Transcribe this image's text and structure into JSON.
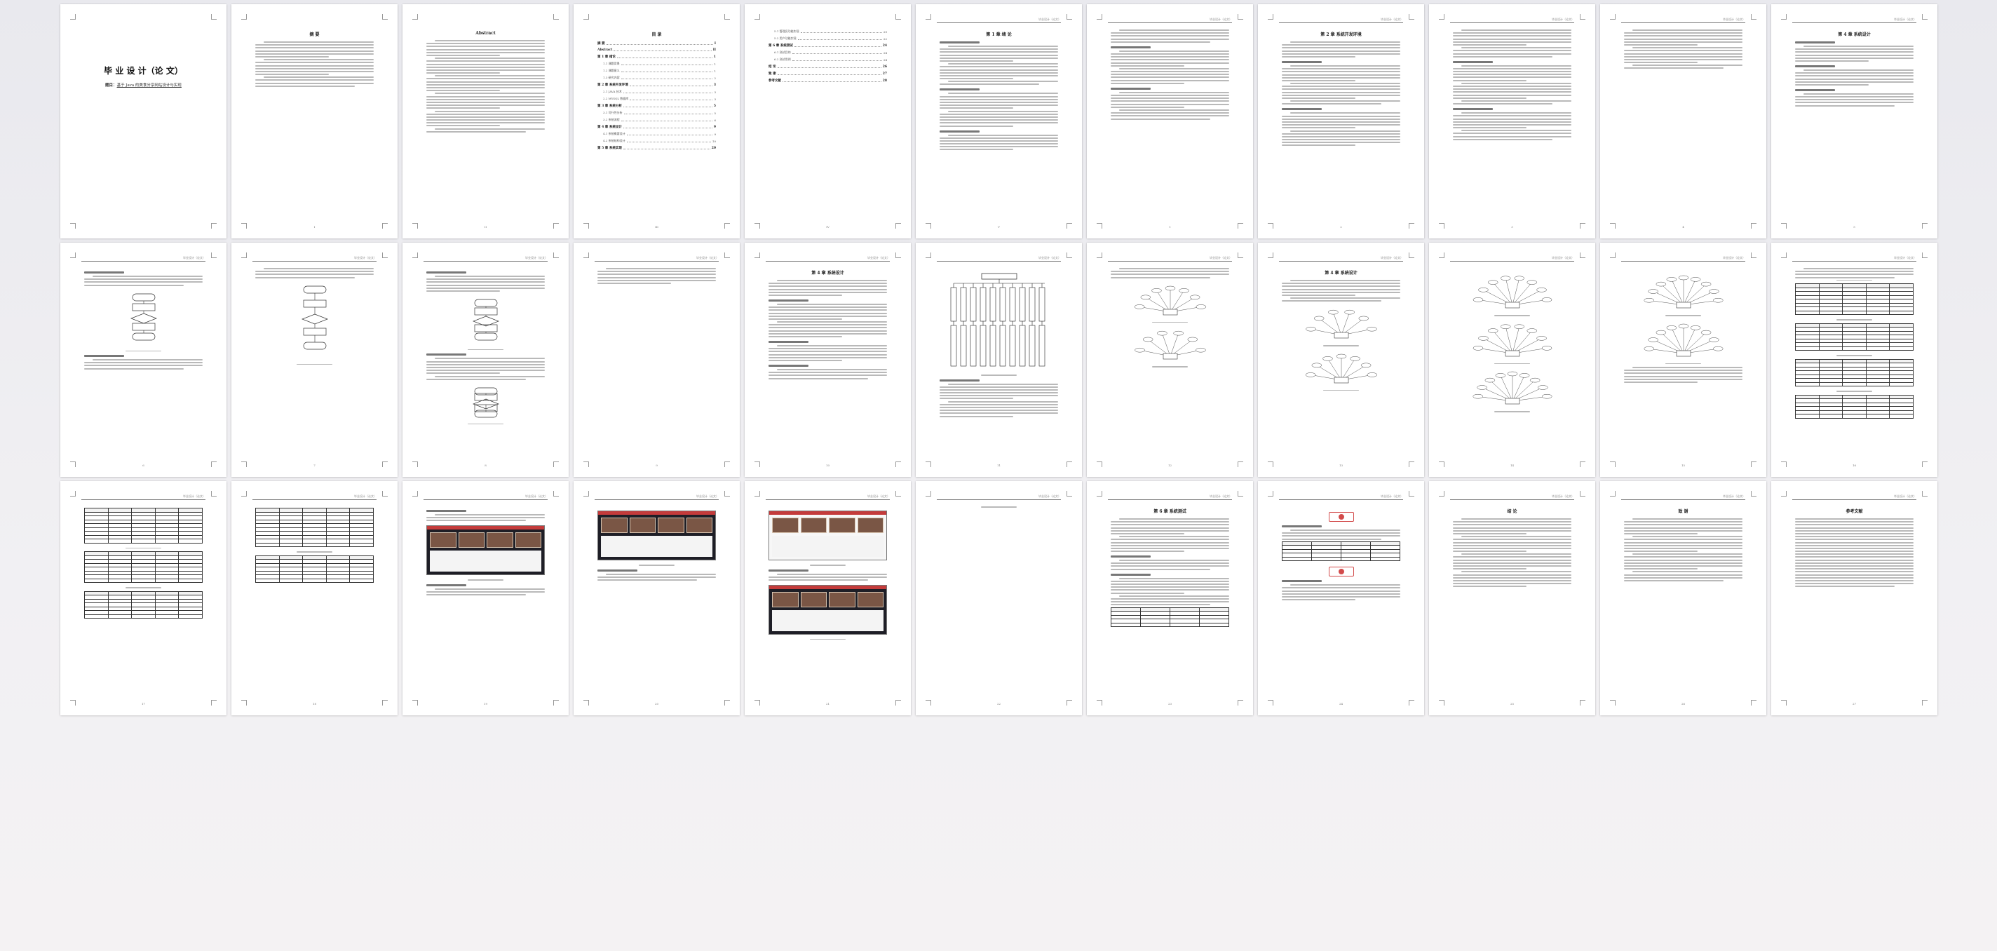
{
  "viewer": {
    "pages_shown": 33
  },
  "cover": {
    "title": "毕 业 设 计（论 文）",
    "subtitle_prefix": "题目：",
    "subtitle": "基于 Java 的美食分享网站设计与实现"
  },
  "headings": {
    "abstract_cn": "摘 要",
    "abstract_en": "Abstract",
    "toc": "目 录",
    "ch1": "第 1 章  绪 论",
    "ch2": "第 2 章  系统开发环境",
    "ch4": "第 4 章  系统设计",
    "ch6": "第 6 章  系统测试",
    "conclusion": "结 论",
    "thanks": "致 谢",
    "references": "参考文献",
    "header_right": "毕业设计（论文）"
  },
  "toc": {
    "rows": [
      {
        "label": "摘 要",
        "page": "I",
        "bold": true
      },
      {
        "label": "Abstract",
        "page": "II",
        "bold": true
      },
      {
        "label": "第 1 章 绪论",
        "page": "1",
        "bold": true
      },
      {
        "label": "1.1 课题背景",
        "page": "1",
        "bold": false
      },
      {
        "label": "1.2 课题意义",
        "page": "1",
        "bold": false
      },
      {
        "label": "1.3 研究内容",
        "page": "2",
        "bold": false
      },
      {
        "label": "第 2 章 系统开发环境",
        "page": "3",
        "bold": true
      },
      {
        "label": "2.1 JAVA 技术",
        "page": "3",
        "bold": false
      },
      {
        "label": "2.2 MYSQL 数据库",
        "page": "3",
        "bold": false
      },
      {
        "label": "第 3 章 系统分析",
        "page": "5",
        "bold": true
      },
      {
        "label": "3.1 可行性分析",
        "page": "5",
        "bold": false
      },
      {
        "label": "3.2 系统流程",
        "page": "6",
        "bold": false
      },
      {
        "label": "第 4 章 系统设计",
        "page": "9",
        "bold": true
      },
      {
        "label": "4.1 系统概要设计",
        "page": "9",
        "bold": false
      },
      {
        "label": "4.2 系统结构设计",
        "page": "10",
        "bold": false
      },
      {
        "label": "第 5 章 系统实现",
        "page": "20",
        "bold": true
      }
    ],
    "rows2": [
      {
        "label": "5.1 管理员功能实现",
        "page": "20",
        "bold": false
      },
      {
        "label": "5.2 用户功能实现",
        "page": "22",
        "bold": false
      },
      {
        "label": "第 6 章 系统测试",
        "page": "24",
        "bold": true
      },
      {
        "label": "6.1 测试目的",
        "page": "24",
        "bold": false
      },
      {
        "label": "6.2 测试用例",
        "page": "24",
        "bold": false
      },
      {
        "label": "结 论",
        "page": "26",
        "bold": true
      },
      {
        "label": "致 谢",
        "page": "27",
        "bold": true
      },
      {
        "label": "参考文献",
        "page": "28",
        "bold": true
      }
    ]
  },
  "page_numbers": [
    "I",
    "II",
    "III",
    "IV",
    "V",
    "1",
    "2",
    "3",
    "4",
    "5",
    "6",
    "7",
    "8",
    "9",
    "10",
    "11",
    "12",
    "13",
    "14",
    "15",
    "16",
    "17",
    "18",
    "19",
    "20",
    "21",
    "22",
    "23",
    "24",
    "25",
    "26",
    "27",
    "28"
  ]
}
